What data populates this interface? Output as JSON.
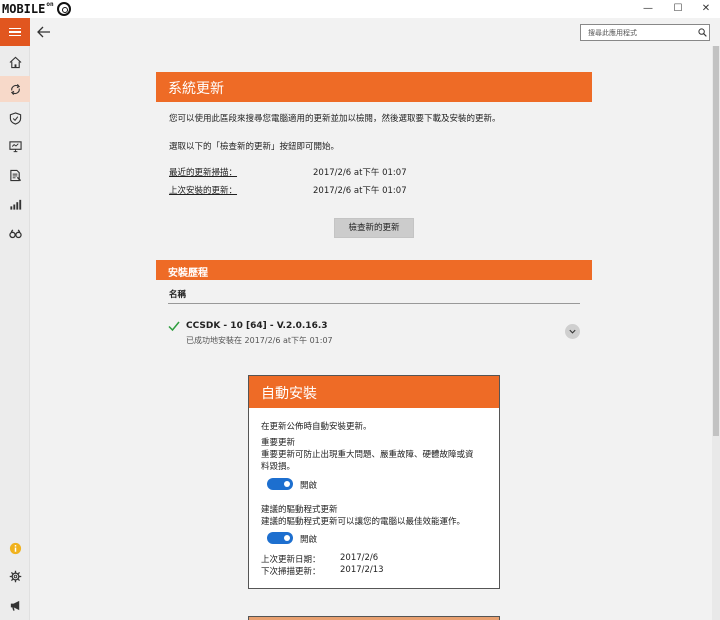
{
  "window": {
    "logo_text": "MOBILE",
    "logo_superscript": "on",
    "controls": [
      "—",
      "☐",
      "✕"
    ]
  },
  "sidebar": {
    "items": [
      {
        "icon": "home-icon"
      },
      {
        "icon": "sync-icon",
        "active": true
      },
      {
        "icon": "shield-icon"
      },
      {
        "icon": "monitor-icon"
      },
      {
        "icon": "document-icon"
      },
      {
        "icon": "bar-chart-icon"
      },
      {
        "icon": "binoculars-icon"
      }
    ],
    "bottom_items": [
      {
        "icon": "info-icon"
      },
      {
        "icon": "gear-icon"
      },
      {
        "icon": "megaphone-icon"
      }
    ]
  },
  "search": {
    "placeholder": "搜尋此應用程式"
  },
  "main": {
    "title": "系統更新",
    "description": "您可以使用此區段來搜尋您電腦適用的更新並加以檢閱，然後選取要下載及安裝的更新。",
    "instruction": "選取以下的「檢查新的更新」按鈕即可開始。",
    "last_scan_label": "最近的更新掃描：",
    "last_scan_value": "2017/2/6 at下午 01:07",
    "last_install_label": "上次安裝的更新：",
    "last_install_value": "2017/2/6 at下午 01:07",
    "check_button": "檢查新的更新"
  },
  "history": {
    "title": "安裝歷程",
    "column_name": "名稱",
    "items": [
      {
        "name": "CCSDK - 10 [64] - V.2.0.16.3",
        "status": "已成功地安裝在 2017/2/6 at下午 01:07"
      }
    ]
  },
  "auto_install": {
    "title": "自動安裝",
    "intro": "在更新公佈時自動安裝更新。",
    "critical_title": "重要更新",
    "critical_desc_1": "重要更新可防止出現重大問題、嚴重故障、硬體故障或資",
    "critical_desc_2": "料毀損。",
    "critical_toggle_label": "開啟",
    "critical_on": true,
    "driver_title": "建議的驅動程式更新",
    "driver_desc": "建議的驅動程式更新可以讓您的電腦以最佳效能運作。",
    "driver_toggle_label": "開啟",
    "driver_on": true,
    "last_update_label": "上次更新日期：",
    "last_update_value": "2017/2/6",
    "next_scan_label": "下次掃描更新：",
    "next_scan_value": "2017/2/13"
  },
  "colors": {
    "accent": "#ee6b26",
    "toggle": "#1d6fcf",
    "success": "#2e9e3e"
  }
}
